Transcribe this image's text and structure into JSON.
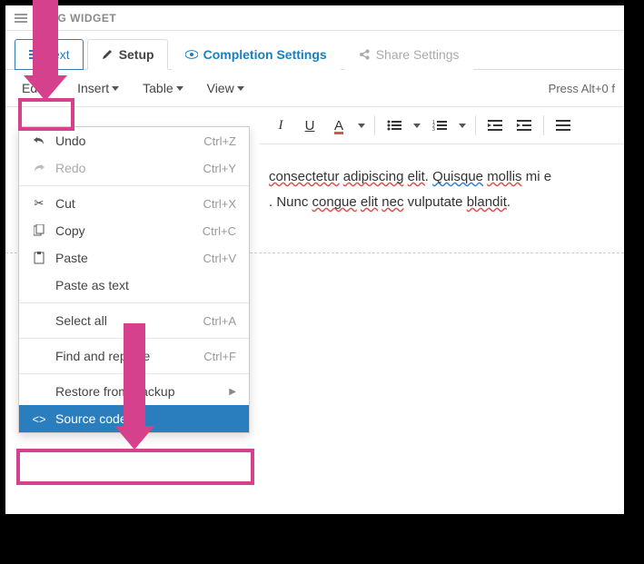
{
  "dragbar": {
    "label": "DRAG WIDGET"
  },
  "tabs": {
    "text": "Text",
    "setup": "Setup",
    "completion": "Completion Settings",
    "share": "Share Settings"
  },
  "menubar": {
    "edit": "Edit",
    "insert": "Insert",
    "table": "Table",
    "view": "View",
    "help": "Press Alt+0 f"
  },
  "toolbar": {
    "italic": "I",
    "underline": "U",
    "textcolor": "A"
  },
  "content": {
    "line1a": "consectetur",
    "line1b": "adipiscing",
    "line1c": "elit",
    "line1d": ". ",
    "line1e": "Quisque",
    "line1f": "mollis",
    "line1g": " mi e",
    "line2a": ". Nunc ",
    "line2b": "congue",
    "line2c": "elit",
    "line2d": "nec",
    "line2e": " vulputate ",
    "line2f": "blandit",
    "line2g": "."
  },
  "dropdown": {
    "undo": {
      "label": "Undo",
      "shortcut": "Ctrl+Z"
    },
    "redo": {
      "label": "Redo",
      "shortcut": "Ctrl+Y"
    },
    "cut": {
      "label": "Cut",
      "shortcut": "Ctrl+X"
    },
    "copy": {
      "label": "Copy",
      "shortcut": "Ctrl+C"
    },
    "paste": {
      "label": "Paste",
      "shortcut": "Ctrl+V"
    },
    "paste_text": {
      "label": "Paste as text"
    },
    "select_all": {
      "label": "Select all",
      "shortcut": "Ctrl+A"
    },
    "find_replace": {
      "label": "Find and replace",
      "shortcut": "Ctrl+F"
    },
    "restore": {
      "label": "Restore from Backup"
    },
    "source": {
      "label": "Source code"
    }
  }
}
